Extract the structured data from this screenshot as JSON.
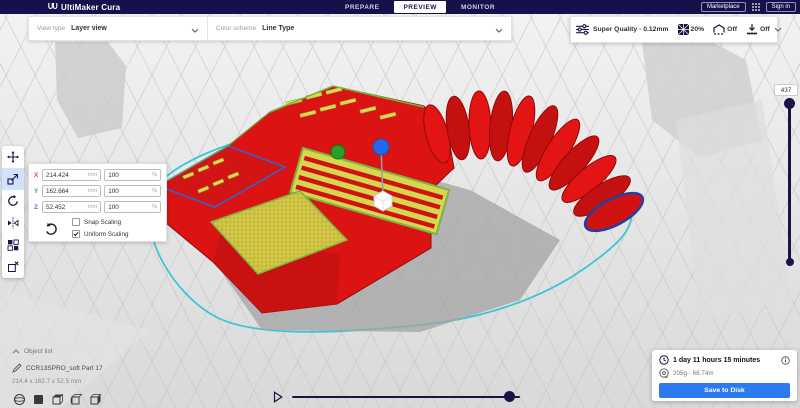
{
  "header": {
    "app_title": "UltiMaker Cura",
    "tabs": [
      {
        "label": "PREPARE",
        "active": false
      },
      {
        "label": "PREVIEW",
        "active": true
      },
      {
        "label": "MONITOR",
        "active": false
      }
    ],
    "marketplace_label": "Marketplace",
    "sign_in_label": "Sign in"
  },
  "view_bar": {
    "view_type_label": "View type",
    "view_type_value": "Layer view",
    "color_scheme_label": "Color scheme",
    "color_scheme_value": "Line Type"
  },
  "print_settings": {
    "profile": "Super Quality - 0.12mm",
    "infill": "20%",
    "support": "Off",
    "adhesion": "Off"
  },
  "left_toolbar": {
    "tools": [
      "move",
      "scale",
      "rotate",
      "mirror",
      "per-model-settings",
      "support-blocker"
    ],
    "active_tool": "scale"
  },
  "scale_panel": {
    "rows": [
      {
        "axis": "X",
        "value": "214.424",
        "unit": "mm",
        "percent": "100",
        "percent_unit": "%"
      },
      {
        "axis": "Y",
        "value": "162.664",
        "unit": "mm",
        "percent": "100",
        "percent_unit": "%"
      },
      {
        "axis": "Z",
        "value": "52.452",
        "unit": "mm",
        "percent": "100",
        "percent_unit": "%"
      }
    ],
    "snap_scaling_label": "Snap Scaling",
    "snap_scaling_checked": false,
    "uniform_scaling_label": "Uniform Scaling",
    "uniform_scaling_checked": true
  },
  "layer_slider": {
    "current_layer": "437"
  },
  "object_list": {
    "title": "Object list",
    "item_name": "CCR13SPRO_soft Part 17",
    "item_dimensions": "214.4 x 162.7 x 52.5 mm"
  },
  "print_summary": {
    "time_estimate": "1 day 11 hours 15 minutes",
    "material_estimate": "205g · 68.74m",
    "save_button_label": "Save to Disk"
  },
  "colors": {
    "header_navy": "#16114b",
    "accent_blue": "#2b7af0",
    "model_red": "#dc1313",
    "infill_yellow": "#d6d64f",
    "shell_green": "#74b73c",
    "brim_cyan": "#2cc2d4",
    "axis_x": "#e04b4b",
    "axis_y": "#3fa65c",
    "axis_z": "#3a7de0"
  }
}
